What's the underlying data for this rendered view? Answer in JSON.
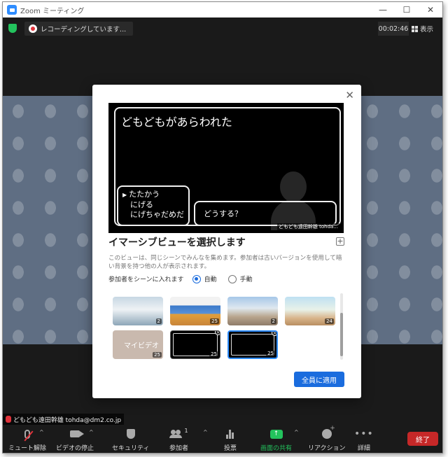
{
  "window": {
    "title": "Zoom ミーティング",
    "controls": [
      "—",
      "☐",
      "✕"
    ]
  },
  "header": {
    "recording_label": "レコーディングしています...",
    "timer": "00:02:46",
    "view_label": "表示"
  },
  "self_tag": {
    "name": "どもども遠田幹雄 tohda@dm2.co.jp"
  },
  "dialog": {
    "close": "✕",
    "preview": {
      "title": "どもどもがあらわれた",
      "menu": [
        "たたかう",
        "にげる",
        "にげちゃだめだ"
      ],
      "message": "どうする？",
      "name": "どもども遠田幹雄 tohda..."
    },
    "heading": "イマーシブビューを選択します",
    "plus": "+",
    "description": "このビューは、同じシーンでみんなを集めます。参加者は古いバージョンを使用して暗い背景を持つ他の人が表示されます。",
    "mode_label": "参加者をシーンに入れます",
    "mode_options": [
      {
        "label": "自動",
        "selected": true
      },
      {
        "label": "手動",
        "selected": false
      }
    ],
    "thumbnails": [
      {
        "count": "2"
      },
      {
        "count": "25"
      },
      {
        "count": "2"
      },
      {
        "count": "24"
      },
      {
        "label": "マイビデオ",
        "count": "25"
      },
      {
        "count": "25"
      },
      {
        "count": "25"
      }
    ],
    "apply_label": "全員に適用"
  },
  "toolbar": {
    "unmute": "ミュート解除",
    "stop_video": "ビデオの停止",
    "security": "セキュリティ",
    "participants": "参加者",
    "participants_count": "1",
    "polls": "投票",
    "share": "画面の共有",
    "reactions": "リアクション",
    "more": "詳細",
    "end": "終了",
    "caret": "^"
  },
  "colors": {
    "accent": "#1a6cde",
    "share_green": "#23c35d",
    "end_red": "#c62828",
    "scene_bg": "#5f6e83"
  }
}
